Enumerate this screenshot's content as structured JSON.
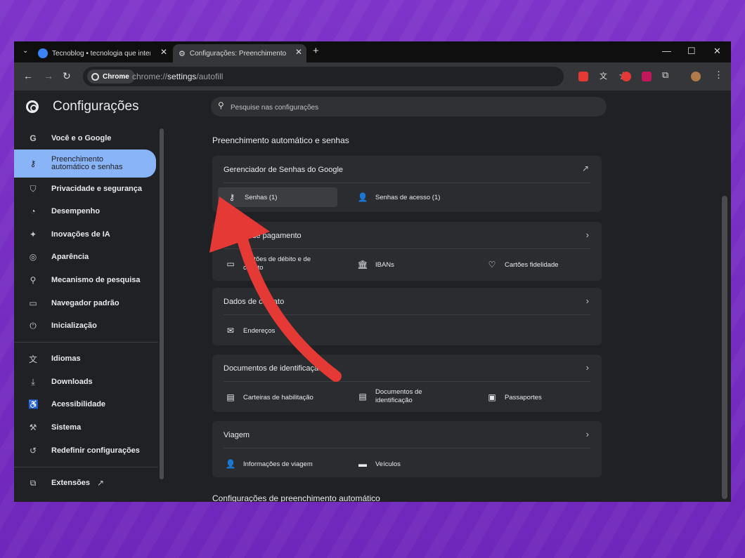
{
  "tabs": [
    {
      "title": "Tecnoblog • tecnologia que interessa",
      "active": false
    },
    {
      "title": "Configurações: Preenchimento automático",
      "active": true
    }
  ],
  "toolbar": {
    "chip_label": "Chrome",
    "url_prefix": "chrome://",
    "url_path": "settings",
    "url_rest": "/autofill"
  },
  "header": {
    "title": "Configurações",
    "search_placeholder": "Pesquise nas configurações"
  },
  "sidebar": {
    "items": [
      {
        "label": "Você e o Google",
        "icon": "google-icon"
      },
      {
        "label": "Preenchimento automático e senhas",
        "icon": "key-icon",
        "selected": true
      },
      {
        "label": "Privacidade e segurança",
        "icon": "shield-icon"
      },
      {
        "label": "Desempenho",
        "icon": "gauge-icon"
      },
      {
        "label": "Inovações de IA",
        "icon": "sparkle-icon"
      },
      {
        "label": "Aparência",
        "icon": "palette-icon"
      },
      {
        "label": "Mecanismo de pesquisa",
        "icon": "search-icon"
      },
      {
        "label": "Navegador padrão",
        "icon": "browser-icon"
      },
      {
        "label": "Inicialização",
        "icon": "power-icon"
      },
      {
        "label": "Idiomas",
        "icon": "translate-icon"
      },
      {
        "label": "Downloads",
        "icon": "download-icon"
      },
      {
        "label": "Acessibilidade",
        "icon": "accessibility-icon"
      },
      {
        "label": "Sistema",
        "icon": "wrench-icon"
      },
      {
        "label": "Redefinir configurações",
        "icon": "reset-icon"
      },
      {
        "label": "Extensões",
        "icon": "puzzle-icon"
      }
    ]
  },
  "main": {
    "section_title": "Preenchimento automático e senhas",
    "password_card": {
      "title": "Gerenciador de Senhas do Google",
      "items": [
        "Senhas (1)",
        "Senhas de acesso (1)"
      ]
    },
    "payment_card": {
      "title": "Formas de pagamento",
      "items": [
        "Cartões de débito e de crédito",
        "IBANs",
        "Cartões fidelidade"
      ]
    },
    "contact_card": {
      "title": "Dados de contato",
      "items": [
        "Endereços"
      ]
    },
    "id_card": {
      "title": "Documentos de identificação",
      "items": [
        "Carteiras de habilitação",
        "Documentos de identificação",
        "Passaportes"
      ]
    },
    "travel_card": {
      "title": "Viagem",
      "items": [
        "Informações de viagem",
        "Veículos"
      ]
    },
    "bottom_heading": "Configurações de preenchimento automático"
  },
  "colors": {
    "accent": "#8ab4f8",
    "arrow": "#e53935",
    "background": "#7b2fc4"
  }
}
